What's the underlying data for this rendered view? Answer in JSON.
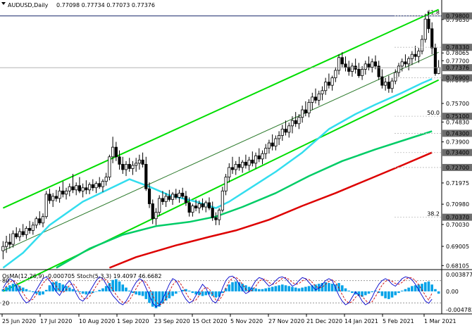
{
  "header": {
    "symbol": "AUDUSD,Daily",
    "ohlc": "0.77098 0.77734 0.77073 0.77376"
  },
  "osc_header": {
    "osma": "OsMA(12,26,9) -0.000705",
    "stoch": "Stoch(5,3,3) 19.4097 46.6682"
  },
  "colors": {
    "bull_candle": "#ffffff",
    "bear_candle": "#000000",
    "channel": "#00dd00",
    "ema_fast": "#33ddee",
    "ema_mid": "#00cc66",
    "ema_slow": "#dd0000",
    "fib_level": "#1a2a6c",
    "highlight_label": "#6e6e6e",
    "osma_hist": "#00a2e8",
    "stoch_main": "#0000cc",
    "stoch_signal": "#cc0000"
  },
  "chart_data": {
    "type": "candlestick",
    "xlabels": [
      "25 Jun 2020",
      "17 Jul 2020",
      "10 Aug 2020",
      "1 Sep 2020",
      "23 Sep 2020",
      "15 Oct 2020",
      "5 Nov 2020",
      "27 Nov 2020",
      "21 Dec 2020",
      "14 Jan 2021",
      "5 Feb 2021",
      "1 Mar 2021"
    ],
    "y_ticks_plain": [
      "0.79630",
      "0.78065",
      "0.77700",
      "0.76795",
      "0.75700",
      "0.74830",
      "0.73900",
      "0.71975",
      "0.70980",
      "0.70030",
      "0.69005",
      "0.68105"
    ],
    "y_ticks_highlight": [
      "0.79800",
      "0.78330",
      "0.77376",
      "0.76900",
      "0.75100",
      "0.74300",
      "0.73400",
      "0.72700",
      "0.70370"
    ],
    "ylim": [
      0.6795,
      0.8015
    ],
    "fib_levels": [
      {
        "label": "61.8",
        "value": 0.798
      },
      {
        "label": "50.0",
        "value": 0.751
      },
      {
        "label": "38.2",
        "value": 0.7037
      }
    ],
    "candles": [
      [
        0.688,
        0.6925,
        0.684,
        0.69
      ],
      [
        0.69,
        0.695,
        0.687,
        0.692
      ],
      [
        0.692,
        0.696,
        0.689,
        0.691
      ],
      [
        0.691,
        0.6975,
        0.6895,
        0.696
      ],
      [
        0.696,
        0.699,
        0.6935,
        0.6945
      ],
      [
        0.6945,
        0.6985,
        0.6925,
        0.697
      ],
      [
        0.697,
        0.7005,
        0.6945,
        0.6955
      ],
      [
        0.6955,
        0.6995,
        0.6935,
        0.6985
      ],
      [
        0.6985,
        0.702,
        0.696,
        0.6975
      ],
      [
        0.6975,
        0.7015,
        0.6955,
        0.7
      ],
      [
        0.7,
        0.704,
        0.6985,
        0.703
      ],
      [
        0.703,
        0.7065,
        0.7,
        0.701
      ],
      [
        0.701,
        0.7055,
        0.699,
        0.704
      ],
      [
        0.704,
        0.716,
        0.703,
        0.7145
      ],
      [
        0.7145,
        0.717,
        0.71,
        0.7115
      ],
      [
        0.7115,
        0.715,
        0.7085,
        0.7135
      ],
      [
        0.7135,
        0.7165,
        0.711,
        0.7125
      ],
      [
        0.7125,
        0.718,
        0.7105,
        0.716
      ],
      [
        0.716,
        0.7205,
        0.713,
        0.7145
      ],
      [
        0.7145,
        0.7175,
        0.712,
        0.716
      ],
      [
        0.716,
        0.7195,
        0.7135,
        0.718
      ],
      [
        0.718,
        0.724,
        0.715,
        0.7165
      ],
      [
        0.7165,
        0.72,
        0.714,
        0.7185
      ],
      [
        0.7185,
        0.7225,
        0.715,
        0.716
      ],
      [
        0.716,
        0.7195,
        0.713,
        0.7175
      ],
      [
        0.7175,
        0.721,
        0.7145,
        0.7165
      ],
      [
        0.7165,
        0.72,
        0.7145,
        0.719
      ],
      [
        0.719,
        0.7215,
        0.716,
        0.7175
      ],
      [
        0.7175,
        0.7205,
        0.715,
        0.7195
      ],
      [
        0.7195,
        0.7225,
        0.717,
        0.718
      ],
      [
        0.718,
        0.7215,
        0.7155,
        0.7205
      ],
      [
        0.7205,
        0.7245,
        0.7185,
        0.7225
      ],
      [
        0.7225,
        0.733,
        0.721,
        0.732
      ],
      [
        0.732,
        0.7414,
        0.729,
        0.7365
      ],
      [
        0.7365,
        0.739,
        0.73,
        0.732
      ],
      [
        0.732,
        0.735,
        0.726,
        0.7285
      ],
      [
        0.7285,
        0.732,
        0.724,
        0.726
      ],
      [
        0.726,
        0.73,
        0.723,
        0.7285
      ],
      [
        0.7285,
        0.7315,
        0.725,
        0.7265
      ],
      [
        0.7265,
        0.73,
        0.7235,
        0.728
      ],
      [
        0.728,
        0.7315,
        0.725,
        0.729
      ],
      [
        0.729,
        0.733,
        0.726,
        0.7305
      ],
      [
        0.7305,
        0.734,
        0.727,
        0.7285
      ],
      [
        0.7285,
        0.732,
        0.716,
        0.717
      ],
      [
        0.717,
        0.72,
        0.708,
        0.71
      ],
      [
        0.71,
        0.712,
        0.7005,
        0.703
      ],
      [
        0.703,
        0.708,
        0.7,
        0.706
      ],
      [
        0.706,
        0.714,
        0.7045,
        0.7125
      ],
      [
        0.7125,
        0.716,
        0.7095,
        0.711
      ],
      [
        0.711,
        0.715,
        0.7085,
        0.7135
      ],
      [
        0.7135,
        0.7165,
        0.711,
        0.712
      ],
      [
        0.712,
        0.7155,
        0.7095,
        0.7145
      ],
      [
        0.7145,
        0.717,
        0.712,
        0.713
      ],
      [
        0.713,
        0.7165,
        0.7105,
        0.715
      ],
      [
        0.715,
        0.7175,
        0.7125,
        0.7135
      ],
      [
        0.7135,
        0.716,
        0.709,
        0.7105
      ],
      [
        0.7105,
        0.713,
        0.704,
        0.706
      ],
      [
        0.706,
        0.71,
        0.704,
        0.709
      ],
      [
        0.709,
        0.712,
        0.7065,
        0.708
      ],
      [
        0.708,
        0.7115,
        0.7055,
        0.71
      ],
      [
        0.71,
        0.7125,
        0.707,
        0.7085
      ],
      [
        0.7085,
        0.7115,
        0.706,
        0.7105
      ],
      [
        0.7105,
        0.713,
        0.707,
        0.708
      ],
      [
        0.708,
        0.711,
        0.702,
        0.7035
      ],
      [
        0.7035,
        0.706,
        0.7,
        0.7025
      ],
      [
        0.7025,
        0.708,
        0.7,
        0.707
      ],
      [
        0.707,
        0.718,
        0.706,
        0.716
      ],
      [
        0.716,
        0.724,
        0.714,
        0.7225
      ],
      [
        0.7225,
        0.729,
        0.72,
        0.727
      ],
      [
        0.727,
        0.732,
        0.724,
        0.726
      ],
      [
        0.726,
        0.73,
        0.7235,
        0.7285
      ],
      [
        0.7285,
        0.732,
        0.7255,
        0.727
      ],
      [
        0.727,
        0.7305,
        0.7245,
        0.7295
      ],
      [
        0.7295,
        0.733,
        0.7265,
        0.728
      ],
      [
        0.728,
        0.732,
        0.7255,
        0.7305
      ],
      [
        0.7305,
        0.7345,
        0.7275,
        0.729
      ],
      [
        0.729,
        0.734,
        0.7265,
        0.7325
      ],
      [
        0.7325,
        0.736,
        0.7295,
        0.731
      ],
      [
        0.731,
        0.735,
        0.7285,
        0.7335
      ],
      [
        0.7335,
        0.738,
        0.731,
        0.736
      ],
      [
        0.736,
        0.74,
        0.7335,
        0.7385
      ],
      [
        0.7385,
        0.7425,
        0.735,
        0.737
      ],
      [
        0.737,
        0.742,
        0.735,
        0.7405
      ],
      [
        0.7405,
        0.744,
        0.7375,
        0.742
      ],
      [
        0.742,
        0.747,
        0.7395,
        0.745
      ],
      [
        0.745,
        0.749,
        0.742,
        0.7435
      ],
      [
        0.7435,
        0.748,
        0.741,
        0.7465
      ],
      [
        0.7465,
        0.751,
        0.743,
        0.749
      ],
      [
        0.749,
        0.753,
        0.746,
        0.7475
      ],
      [
        0.7475,
        0.752,
        0.745,
        0.7505
      ],
      [
        0.7505,
        0.756,
        0.748,
        0.754
      ],
      [
        0.754,
        0.758,
        0.751,
        0.7525
      ],
      [
        0.7525,
        0.759,
        0.7505,
        0.7575
      ],
      [
        0.7575,
        0.762,
        0.754,
        0.76
      ],
      [
        0.76,
        0.764,
        0.757,
        0.7585
      ],
      [
        0.7585,
        0.763,
        0.756,
        0.7615
      ],
      [
        0.7615,
        0.765,
        0.7585,
        0.763
      ],
      [
        0.763,
        0.769,
        0.761,
        0.767
      ],
      [
        0.767,
        0.771,
        0.764,
        0.7655
      ],
      [
        0.7655,
        0.77,
        0.763,
        0.769
      ],
      [
        0.769,
        0.774,
        0.767,
        0.7725
      ],
      [
        0.7725,
        0.78,
        0.7705,
        0.7785
      ],
      [
        0.7785,
        0.781,
        0.774,
        0.7755
      ],
      [
        0.7755,
        0.779,
        0.772,
        0.774
      ],
      [
        0.774,
        0.777,
        0.77,
        0.772
      ],
      [
        0.772,
        0.776,
        0.7695,
        0.7745
      ],
      [
        0.7745,
        0.778,
        0.771,
        0.773
      ],
      [
        0.773,
        0.776,
        0.769,
        0.77
      ],
      [
        0.77,
        0.7745,
        0.768,
        0.773
      ],
      [
        0.773,
        0.777,
        0.7705,
        0.7755
      ],
      [
        0.7755,
        0.779,
        0.7725,
        0.774
      ],
      [
        0.774,
        0.778,
        0.7715,
        0.7765
      ],
      [
        0.7765,
        0.7795,
        0.773,
        0.7745
      ],
      [
        0.7745,
        0.777,
        0.768,
        0.7695
      ],
      [
        0.7695,
        0.773,
        0.764,
        0.7655
      ],
      [
        0.7655,
        0.769,
        0.763,
        0.767
      ],
      [
        0.767,
        0.77,
        0.762,
        0.764
      ],
      [
        0.764,
        0.769,
        0.762,
        0.7675
      ],
      [
        0.7675,
        0.773,
        0.766,
        0.7715
      ],
      [
        0.7715,
        0.776,
        0.7695,
        0.7745
      ],
      [
        0.7745,
        0.778,
        0.772,
        0.7765
      ],
      [
        0.7765,
        0.78,
        0.774,
        0.7755
      ],
      [
        0.7755,
        0.779,
        0.7725,
        0.778
      ],
      [
        0.778,
        0.7815,
        0.775,
        0.78
      ],
      [
        0.78,
        0.784,
        0.777,
        0.779
      ],
      [
        0.779,
        0.783,
        0.776,
        0.7815
      ],
      [
        0.7815,
        0.789,
        0.78,
        0.787
      ],
      [
        0.787,
        0.799,
        0.7855,
        0.7965
      ],
      [
        0.7965,
        0.8,
        0.79,
        0.792
      ],
      [
        0.792,
        0.795,
        0.78,
        0.783
      ],
      [
        0.783,
        0.785,
        0.77,
        0.771
      ],
      [
        0.771,
        0.7773,
        0.7707,
        0.7738
      ]
    ],
    "ema_fast": [
      [
        0,
        0.68
      ],
      [
        6,
        0.687
      ],
      [
        14,
        0.7
      ],
      [
        24,
        0.711
      ],
      [
        32,
        0.717
      ],
      [
        38,
        0.7215
      ],
      [
        44,
        0.718
      ],
      [
        50,
        0.714
      ],
      [
        58,
        0.711
      ],
      [
        64,
        0.708
      ],
      [
        68,
        0.711
      ],
      [
        74,
        0.717
      ],
      [
        82,
        0.725
      ],
      [
        90,
        0.734
      ],
      [
        98,
        0.745
      ],
      [
        106,
        0.752
      ],
      [
        112,
        0.7565
      ],
      [
        120,
        0.762
      ],
      [
        126,
        0.7665
      ],
      [
        129,
        0.7685
      ]
    ],
    "ema_mid": [
      [
        16,
        0.68
      ],
      [
        26,
        0.689
      ],
      [
        36,
        0.6955
      ],
      [
        46,
        0.6995
      ],
      [
        56,
        0.7015
      ],
      [
        64,
        0.704
      ],
      [
        72,
        0.7085
      ],
      [
        82,
        0.715
      ],
      [
        92,
        0.723
      ],
      [
        102,
        0.73
      ],
      [
        112,
        0.7355
      ],
      [
        122,
        0.7405
      ],
      [
        129,
        0.744
      ]
    ],
    "ema_slow": [
      [
        32,
        0.68
      ],
      [
        40,
        0.685
      ],
      [
        52,
        0.6905
      ],
      [
        62,
        0.6945
      ],
      [
        70,
        0.6975
      ],
      [
        80,
        0.7025
      ],
      [
        90,
        0.709
      ],
      [
        100,
        0.715
      ],
      [
        110,
        0.7215
      ],
      [
        120,
        0.728
      ],
      [
        129,
        0.734
      ]
    ],
    "channel_lines": [
      {
        "name": "upper",
        "from": [
          0,
          0.708
        ],
        "to": [
          131,
          0.801
        ]
      },
      {
        "name": "mid",
        "from": [
          0,
          0.688
        ],
        "to": [
          131,
          0.781
        ]
      },
      {
        "name": "lower",
        "from": [
          0,
          0.669
        ],
        "to": [
          131,
          0.768
        ]
      }
    ],
    "oscillator": {
      "y_ticks": [
        "0.0038774",
        "0.00",
        "-0.004782"
      ],
      "stoch_levels": [
        "80",
        "20"
      ],
      "osma": [
        0.3,
        0.6,
        0.8,
        1.0,
        0.9,
        0.7,
        0.5,
        0.3,
        0.1,
        -0.1,
        -0.3,
        -0.5,
        -0.4,
        0.2,
        0.8,
        1.2,
        1.3,
        1.1,
        0.9,
        0.7,
        0.5,
        0.3,
        0.1,
        -0.1,
        -0.3,
        -0.4,
        -0.3,
        -0.2,
        0.0,
        0.2,
        0.4,
        0.7,
        1.1,
        1.5,
        1.6,
        1.3,
        0.9,
        0.5,
        0.1,
        -0.2,
        -0.4,
        -0.5,
        -0.6,
        -1.0,
        -1.5,
        -2.0,
        -2.2,
        -2.0,
        -1.6,
        -1.2,
        -0.9,
        -0.6,
        -0.3,
        0.0,
        0.2,
        0.3,
        0.1,
        -0.2,
        -0.4,
        -0.5,
        -0.6,
        -0.5,
        -0.4,
        -0.6,
        -0.8,
        -0.7,
        -0.2,
        0.4,
        0.9,
        1.2,
        1.3,
        1.2,
        1.0,
        0.8,
        0.6,
        0.5,
        0.4,
        0.3,
        0.3,
        0.4,
        0.5,
        0.6,
        0.7,
        0.8,
        0.9,
        0.8,
        0.7,
        0.6,
        0.5,
        0.4,
        0.5,
        0.6,
        0.7,
        0.8,
        0.9,
        1.0,
        1.1,
        1.2,
        1.1,
        1.0,
        0.9,
        1.1,
        0.8,
        0.4,
        0.1,
        -0.2,
        -0.4,
        -0.6,
        -0.7,
        -0.5,
        -0.3,
        -0.1,
        0.1,
        -0.2,
        -0.6,
        -0.9,
        -1.0,
        -0.8,
        -0.5,
        -0.2,
        0.1,
        0.3,
        0.5,
        0.7,
        0.8,
        0.9,
        1.0,
        1.2,
        1.3,
        0.9,
        0.3,
        -0.3
      ],
      "stoch_main": [
        60,
        75,
        85,
        80,
        65,
        45,
        30,
        20,
        25,
        40,
        55,
        70,
        85,
        90,
        80,
        65,
        50,
        40,
        55,
        70,
        80,
        65,
        45,
        30,
        25,
        35,
        50,
        65,
        80,
        90,
        85,
        70,
        55,
        40,
        30,
        20,
        15,
        25,
        40,
        60,
        75,
        85,
        80,
        60,
        40,
        20,
        10,
        15,
        30,
        50,
        70,
        85,
        80,
        65,
        45,
        30,
        20,
        25,
        40,
        55,
        70,
        60,
        40,
        25,
        20,
        35,
        60,
        80,
        90,
        92,
        85,
        70,
        55,
        45,
        50,
        65,
        80,
        88,
        85,
        75,
        65,
        70,
        80,
        88,
        90,
        85,
        75,
        65,
        70,
        80,
        88,
        85,
        75,
        65,
        55,
        60,
        70,
        80,
        85,
        80,
        60,
        40,
        25,
        15,
        20,
        35,
        50,
        40,
        25,
        15,
        20,
        35,
        55,
        70,
        80,
        85,
        80,
        70,
        65,
        75,
        85,
        90,
        88,
        82,
        70,
        55,
        40,
        25,
        19,
        30
      ],
      "stoch_signal": [
        55,
        65,
        75,
        80,
        75,
        62,
        47,
        33,
        26,
        30,
        42,
        57,
        72,
        83,
        86,
        78,
        65,
        52,
        48,
        55,
        68,
        72,
        63,
        47,
        33,
        30,
        37,
        50,
        65,
        78,
        85,
        82,
        70,
        55,
        42,
        30,
        22,
        20,
        27,
        42,
        58,
        73,
        80,
        75,
        60,
        40,
        23,
        15,
        18,
        32,
        50,
        68,
        78,
        77,
        63,
        47,
        32,
        25,
        28,
        40,
        55,
        62,
        58,
        42,
        28,
        27,
        40,
        60,
        77,
        87,
        89,
        82,
        70,
        57,
        50,
        55,
        65,
        78,
        84,
        83,
        75,
        70,
        72,
        79,
        86,
        88,
        83,
        75,
        70,
        72,
        79,
        84,
        83,
        75,
        65,
        60,
        62,
        70,
        78,
        82,
        75,
        60,
        42,
        27,
        20,
        23,
        35,
        42,
        38,
        27,
        20,
        23,
        37,
        53,
        68,
        78,
        82,
        78,
        72,
        70,
        75,
        83,
        88,
        87,
        80,
        69,
        55,
        40,
        28,
        46
      ]
    }
  }
}
